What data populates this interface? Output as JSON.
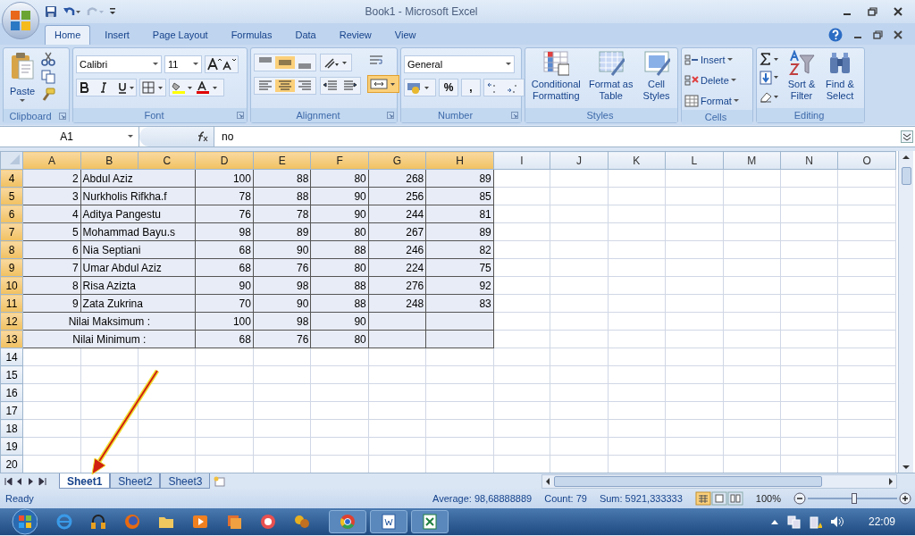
{
  "window": {
    "title": "Book1 - Microsoft Excel"
  },
  "ribbon_tabs": [
    {
      "label": "Home",
      "selected": true
    },
    {
      "label": "Insert",
      "selected": false
    },
    {
      "label": "Page Layout",
      "selected": false
    },
    {
      "label": "Formulas",
      "selected": false
    },
    {
      "label": "Data",
      "selected": false
    },
    {
      "label": "Review",
      "selected": false
    },
    {
      "label": "View",
      "selected": false
    }
  ],
  "ribbon": {
    "clipboard": {
      "label": "Clipboard",
      "paste": "Paste"
    },
    "font": {
      "label": "Font",
      "font_name": "Calibri",
      "font_size": "11"
    },
    "alignment": {
      "label": "Alignment"
    },
    "number": {
      "label": "Number",
      "format": "General",
      "buttons": [
        "%",
        ","
      ]
    },
    "styles": {
      "label": "Styles",
      "buttons": [
        "Conditional Formatting",
        "Format as Table",
        "Cell Styles"
      ]
    },
    "cells": {
      "label": "Cells",
      "buttons": [
        "Insert",
        "Delete",
        "Format"
      ]
    },
    "editing": {
      "label": "Editing",
      "buttons": [
        "Sort & Filter",
        "Find & Select"
      ]
    }
  },
  "formula_bar": {
    "name_box": "A1",
    "formula": "no"
  },
  "columns": [
    {
      "label": "A",
      "selected": true
    },
    {
      "label": "B",
      "selected": true
    },
    {
      "label": "C",
      "selected": true
    },
    {
      "label": "D",
      "selected": true
    },
    {
      "label": "E",
      "selected": true
    },
    {
      "label": "F",
      "selected": true
    },
    {
      "label": "G",
      "selected": true
    },
    {
      "label": "H",
      "selected": true
    },
    {
      "label": "I",
      "selected": false
    },
    {
      "label": "J",
      "selected": false
    },
    {
      "label": "K",
      "selected": false
    },
    {
      "label": "L",
      "selected": false
    },
    {
      "label": "M",
      "selected": false
    },
    {
      "label": "N",
      "selected": false
    },
    {
      "label": "O",
      "selected": false
    }
  ],
  "rows": [
    {
      "number": "4",
      "selected": true,
      "kind": "student",
      "cells": [
        "2",
        "Abdul Aziz",
        "100",
        "88",
        "80",
        "268",
        "89"
      ]
    },
    {
      "number": "5",
      "selected": true,
      "kind": "student",
      "cells": [
        "3",
        "Nurkholis Rifkha.f",
        "78",
        "88",
        "90",
        "256",
        "85"
      ]
    },
    {
      "number": "6",
      "selected": true,
      "kind": "student",
      "cells": [
        "4",
        "Aditya Pangestu",
        "76",
        "78",
        "90",
        "244",
        "81"
      ]
    },
    {
      "number": "7",
      "selected": true,
      "kind": "student",
      "cells": [
        "5",
        "Mohammad Bayu.s",
        "98",
        "89",
        "80",
        "267",
        "89"
      ]
    },
    {
      "number": "8",
      "selected": true,
      "kind": "student",
      "cells": [
        "6",
        "Nia Septiani",
        "68",
        "90",
        "88",
        "246",
        "82"
      ]
    },
    {
      "number": "9",
      "selected": true,
      "kind": "student",
      "cells": [
        "7",
        "Umar Abdul Aziz",
        "68",
        "76",
        "80",
        "224",
        "75"
      ]
    },
    {
      "number": "10",
      "selected": true,
      "kind": "student",
      "cells": [
        "8",
        "Risa Azizta",
        "90",
        "98",
        "88",
        "276",
        "92"
      ]
    },
    {
      "number": "11",
      "selected": true,
      "kind": "student",
      "cells": [
        "9",
        "Zata Zukrina",
        "70",
        "90",
        "88",
        "248",
        "83"
      ]
    },
    {
      "number": "12",
      "selected": true,
      "kind": "summary",
      "cells": [
        "Nilai Maksimum :",
        "100",
        "98",
        "90"
      ]
    },
    {
      "number": "13",
      "selected": true,
      "kind": "summary",
      "cells": [
        "Nilai Minimum :",
        "68",
        "76",
        "80"
      ]
    },
    {
      "number": "14",
      "selected": false,
      "kind": "empty"
    },
    {
      "number": "15",
      "selected": false,
      "kind": "empty"
    },
    {
      "number": "16",
      "selected": false,
      "kind": "empty"
    },
    {
      "number": "17",
      "selected": false,
      "kind": "empty"
    },
    {
      "number": "18",
      "selected": false,
      "kind": "empty"
    },
    {
      "number": "19",
      "selected": false,
      "kind": "empty"
    },
    {
      "number": "20",
      "selected": false,
      "kind": "empty"
    }
  ],
  "sheet_tabs": [
    {
      "label": "Sheet1",
      "selected": true
    },
    {
      "label": "Sheet2",
      "selected": false
    },
    {
      "label": "Sheet3",
      "selected": false
    }
  ],
  "status_bar": {
    "mode": "Ready",
    "average": "Average: 98,68888889",
    "count": "Count: 79",
    "sum": "Sum: 5921,333333",
    "zoom": "100%",
    "zoom_level": {
      "level": 0.52
    }
  },
  "taskbar": {
    "clock": "22:09"
  }
}
